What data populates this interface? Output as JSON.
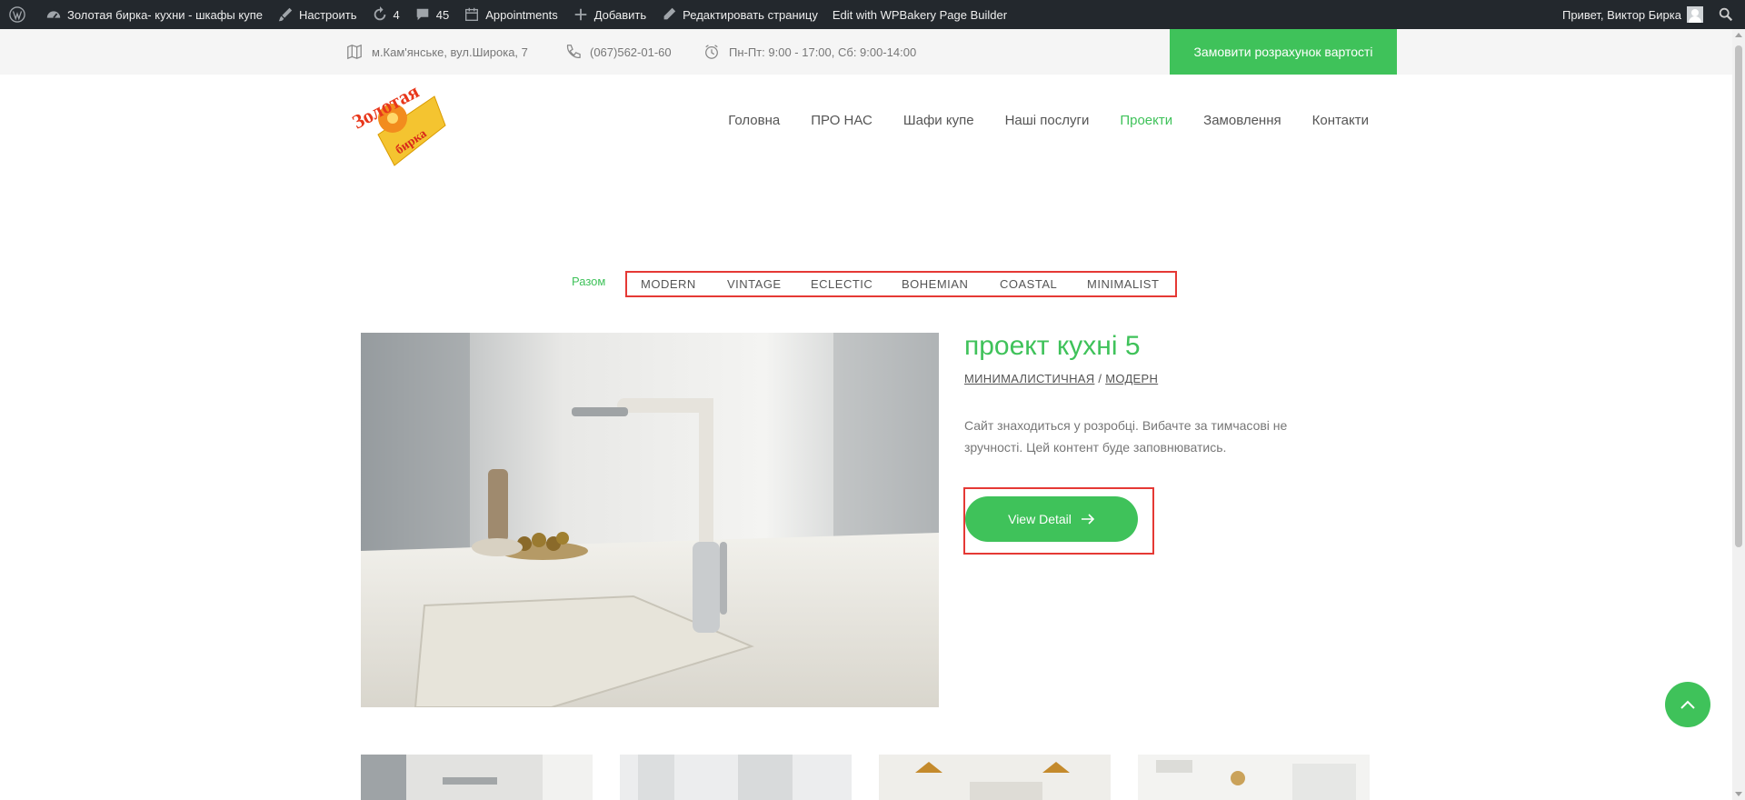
{
  "admin_bar": {
    "site_name": "Золотая бирка- кухни - шкафы купе",
    "customize": "Настроить",
    "updates_count": "4",
    "comments_count": "45",
    "appointments": "Appointments",
    "add_new": "Добавить",
    "edit_page": "Редактировать страницу",
    "wpbakery": "Edit with WPBakery Page Builder",
    "greeting": "Привет, Виктор Бирка"
  },
  "info_bar": {
    "address": "м.Кам'янське, вул.Широка, 7",
    "phone": "(067)562-01-60",
    "hours": "Пн-Пт: 9:00 - 17:00, Сб: 9:00-14:00",
    "cta": "Замовити розрахунок вартості"
  },
  "nav": {
    "items": [
      "Головна",
      "ПРО НАС",
      "Шафи купе",
      "Наші послуги",
      "Проекти",
      "Замовлення",
      "Контакти"
    ],
    "active": "Проекти"
  },
  "logo": {
    "line1": "Золотая",
    "line2": "бирка"
  },
  "filter": {
    "all": "Разом",
    "items": [
      "MODERN",
      "VINTAGE",
      "ECLECTIC",
      "BOHEMIAN",
      "COASTAL",
      "MINIMALIST"
    ]
  },
  "project": {
    "title": "проект кухні 5",
    "category1": "МИНИМАЛИСТИЧНАЯ",
    "separator": "/",
    "category2": "МОДЕРН",
    "description": "Сайт знаходиться у розробці. Вибачте за тимчасові не зручності. Цей контент буде заповнюватись.",
    "button": "View Detail"
  },
  "colors": {
    "accent": "#3fc25a",
    "admin_bar": "#23282d",
    "highlight": "#e53935"
  }
}
